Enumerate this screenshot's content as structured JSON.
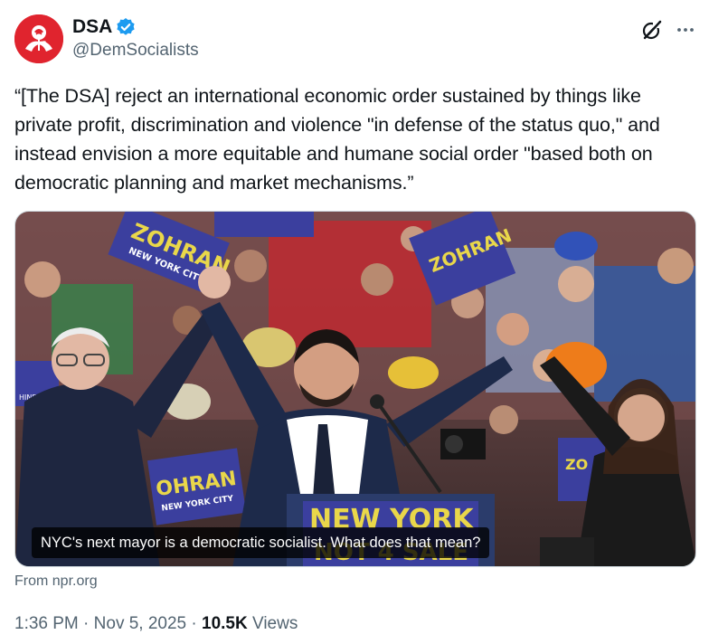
{
  "author": {
    "display_name": "DSA",
    "handle": "@DemSocialists",
    "verified": true,
    "avatar_color": "#e0242e",
    "verified_color": "#1d9bf0"
  },
  "actions": {
    "grok_icon": "grok-slash-circle-icon",
    "more_icon": "more-horizontal-icon"
  },
  "tweet": {
    "text": "“[The DSA] reject an international economic order sustained by things like private profit, discrimination and violence \"in defense of the status quo,\" and instead envision a more equitable and humane social order \"based both on democratic planning and market mechanisms.”"
  },
  "media": {
    "caption": "NYC's next mayor is a democratic socialist. What does that mean?",
    "source": "From npr.org"
  },
  "meta": {
    "time": "1:36 PM",
    "date": "Nov 5, 2025",
    "views_count": "10.5K",
    "views_label": "Views",
    "separator": "·"
  },
  "colors": {
    "text_primary": "#0f1419",
    "text_secondary": "#536471",
    "sign_blue": "#3b3f9e"
  }
}
